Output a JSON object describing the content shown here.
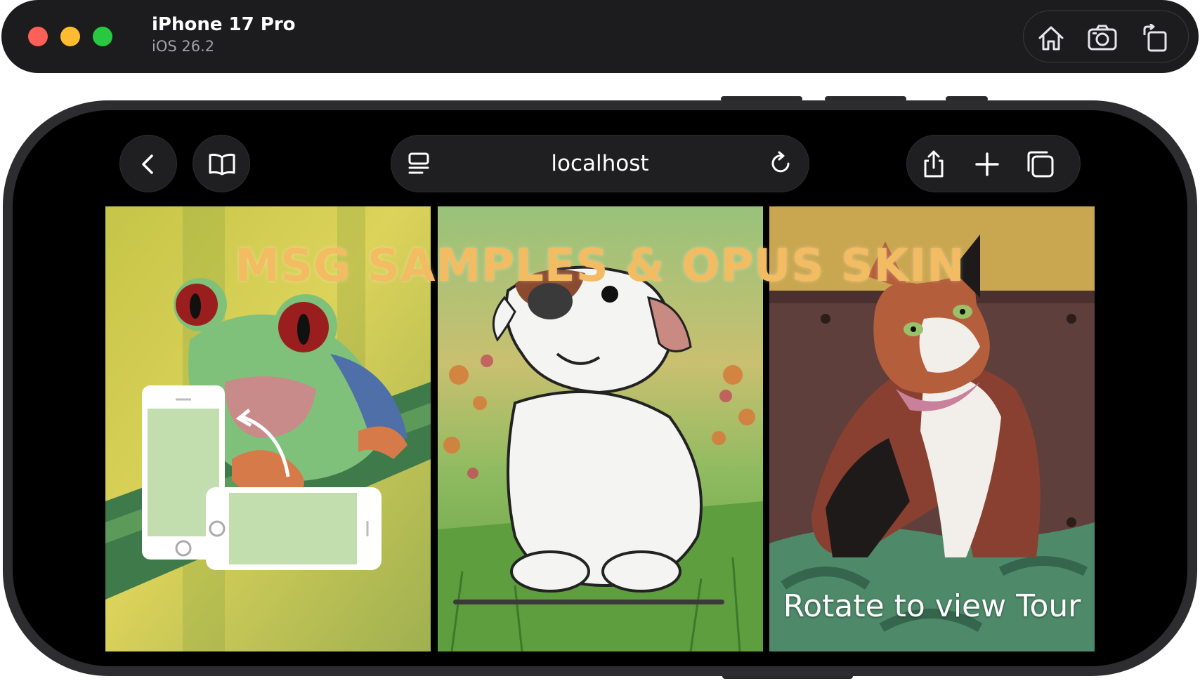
{
  "simulator": {
    "device_name": "iPhone 17 Pro",
    "os_version": "iOS 26.2",
    "tools": [
      "home-icon",
      "screenshot-icon",
      "rotate-icon"
    ]
  },
  "safari": {
    "url": "localhost",
    "left_buttons": [
      "back-chevron-icon",
      "bookmarks-icon"
    ],
    "url_bar_icons": [
      "tab-overview-icon",
      "reload-icon"
    ],
    "right_buttons": [
      "share-icon",
      "new-tab-icon",
      "tabs-icon"
    ]
  },
  "page": {
    "headline": "MSG SAMPLES & OPUS SKIN",
    "rotate_prompt": "Rotate to view Tour",
    "headline_color": "#f3bc62",
    "panels": [
      "frog",
      "dog",
      "cat"
    ]
  }
}
